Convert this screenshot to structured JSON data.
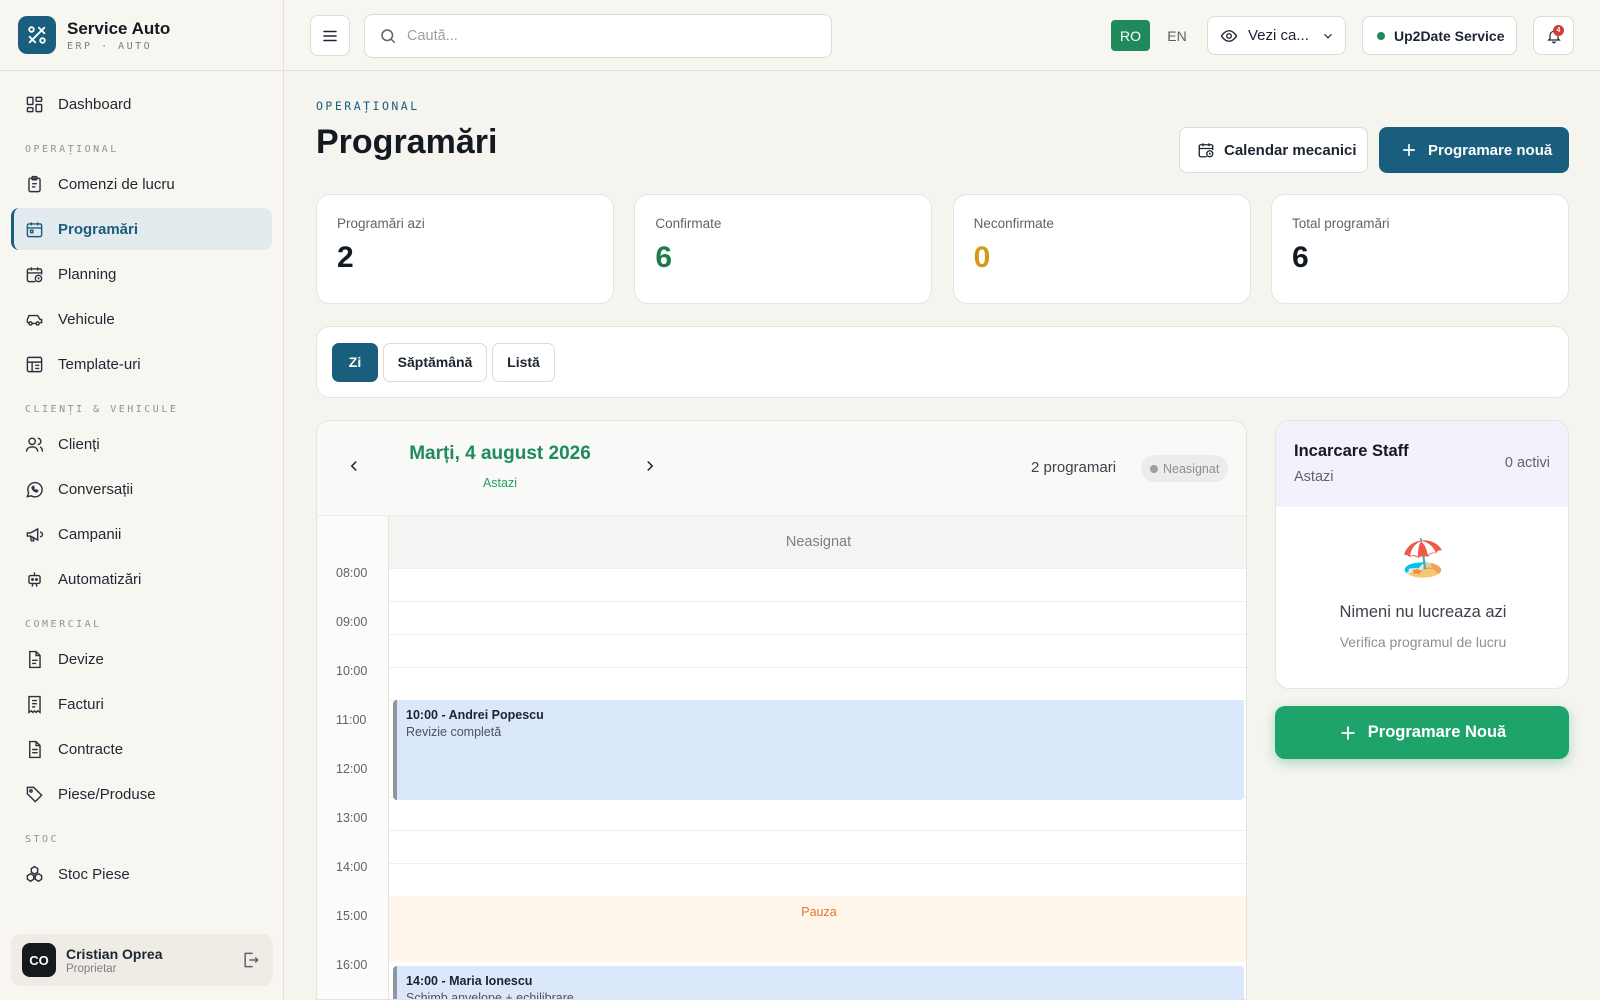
{
  "brand": {
    "name": "Service Auto",
    "sub": "ERP · AUTO"
  },
  "sidebar": {
    "dashboard": "Dashboard",
    "sections": {
      "operational": "OPERAȚIONAL",
      "clients": "CLIENȚI & VEHICULE",
      "commercial": "COMERCIAL",
      "stock": "STOC"
    },
    "items": {
      "work_orders": "Comenzi de lucru",
      "appointments": "Programări",
      "planning": "Planning",
      "vehicles": "Vehicule",
      "templates": "Template-uri",
      "clients": "Clienți",
      "conversations": "Conversații",
      "campaigns": "Campanii",
      "automations": "Automatizări",
      "quotes": "Devize",
      "invoices": "Facturi",
      "contracts": "Contracte",
      "parts": "Piese/Produse",
      "stock_parts": "Stoc Piese"
    },
    "user": {
      "initials": "CO",
      "name": "Cristian Oprea",
      "role": "Proprietar"
    }
  },
  "topbar": {
    "search_placeholder": "Caută...",
    "lang_ro": "RO",
    "lang_en": "EN",
    "view_as": "Vezi ca...",
    "service": "Up2Date Service",
    "notifications_count": "4"
  },
  "page": {
    "eyebrow": "OPERAȚIONAL",
    "title": "Programări",
    "btn_calendar": "Calendar mecanici",
    "btn_new": "Programare nouă"
  },
  "stats": [
    {
      "label": "Programări azi",
      "value": "2",
      "color": "#141a22"
    },
    {
      "label": "Confirmate",
      "value": "6",
      "color": "#1f7a4f"
    },
    {
      "label": "Neconfirmate",
      "value": "0",
      "color": "#d49a1c"
    },
    {
      "label": "Total programări",
      "value": "6",
      "color": "#141a22"
    }
  ],
  "view_tabs": {
    "day": "Zi",
    "week": "Săptămână",
    "list": "Listă"
  },
  "calendar": {
    "date": "Marți, 4 august 2026",
    "today": "Astazi",
    "count": "2 programari",
    "chip": "Neasignat",
    "column": "Neasignat",
    "hours": [
      "08:00",
      "09:00",
      "10:00",
      "11:00",
      "12:00",
      "13:00",
      "14:00",
      "15:00",
      "16:00"
    ],
    "pause": "Pauza",
    "appointments": [
      {
        "title": "10:00 - Andrei Popescu",
        "service": "Revizie completă"
      },
      {
        "title": "14:00 - Maria Ionescu",
        "service": "Schimb anvelope + echilibrare"
      }
    ]
  },
  "staff": {
    "title": "Incarcare Staff",
    "sub": "Astazi",
    "active": "0 activi",
    "emoji": "🏖️",
    "empty": "Nimeni nu lucreaza azi",
    "hint": "Verifica programul de lucru"
  },
  "btn_new_green": "Programare Nouă"
}
